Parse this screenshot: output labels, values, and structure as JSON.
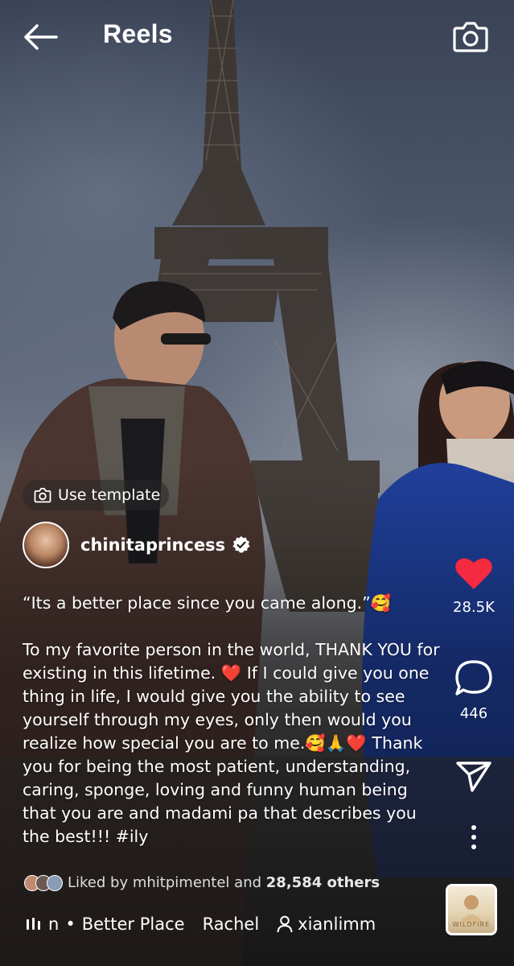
{
  "header": {
    "title": "Reels"
  },
  "template_button": {
    "label": "Use template"
  },
  "author": {
    "username": "chinitaprincess"
  },
  "caption": {
    "paragraph_1": "“Its a better place since you came along.”🥰",
    "paragraph_2": "To my favorite person in the world, THANK YOU for existing in this lifetime. ❤️ If I could give you one thing in life, I would give you the ability to see yourself through my eyes, only then would you realize how special you are to me.🥰🙏❤️ Thank you for being the most patient, understanding, caring, sponge, loving and funny human being that you are and madami pa that describes you the best!!! #ily"
  },
  "actions": {
    "likes": "28.5K",
    "comments": "446"
  },
  "liked_by": {
    "prefix": "Liked by",
    "user": "mhitpimentel",
    "and": "and",
    "others": "28,584 others"
  },
  "audio": {
    "prefix": "n",
    "song": "Better Place",
    "artist": "Rachel",
    "tagged_user": "xianlimm"
  },
  "album": {
    "art_text": "WILDFIRE"
  },
  "colors": {
    "like_heart": "#f5293f",
    "verified": "#ffffff"
  }
}
